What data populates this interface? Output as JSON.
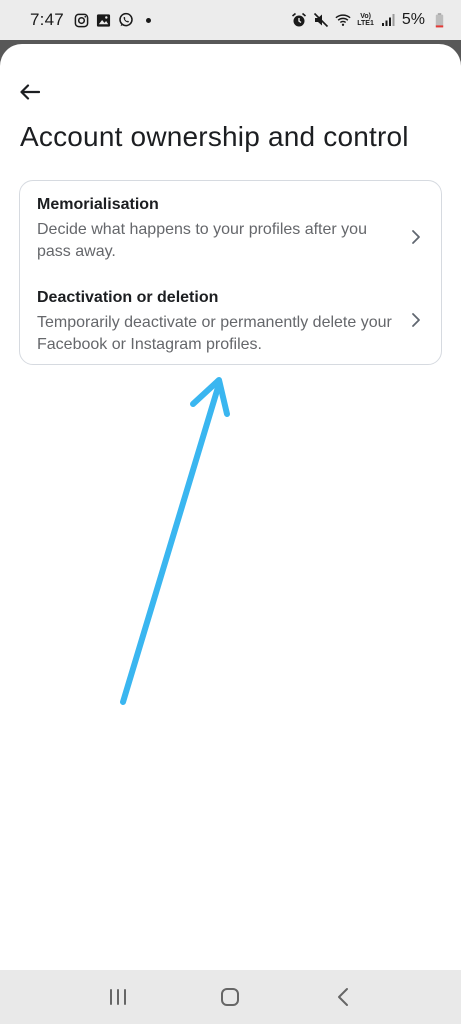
{
  "status_bar": {
    "time": "7:47",
    "left_icons": [
      "instagram-icon",
      "gallery-icon",
      "whatsapp-icon"
    ],
    "right_icons": [
      "alarm-icon",
      "mute-icon",
      "wifi-icon",
      "volte-icon",
      "signal-icon"
    ],
    "volte_top": "Vo)",
    "volte_bottom": "LTE1",
    "battery": "5%"
  },
  "header": {
    "title": "Account ownership and control"
  },
  "options": [
    {
      "title": "Memorialisation",
      "description": "Decide what happens to your profiles after you pass away."
    },
    {
      "title": "Deactivation or deletion",
      "description": "Temporarily deactivate or permanently delete your Facebook or Instagram profiles."
    }
  ],
  "annotation": {
    "arrow_color": "#3ab6f0"
  },
  "nav_bar": {
    "buttons": [
      "recent-apps-icon",
      "home-icon",
      "back-nav-icon"
    ]
  }
}
